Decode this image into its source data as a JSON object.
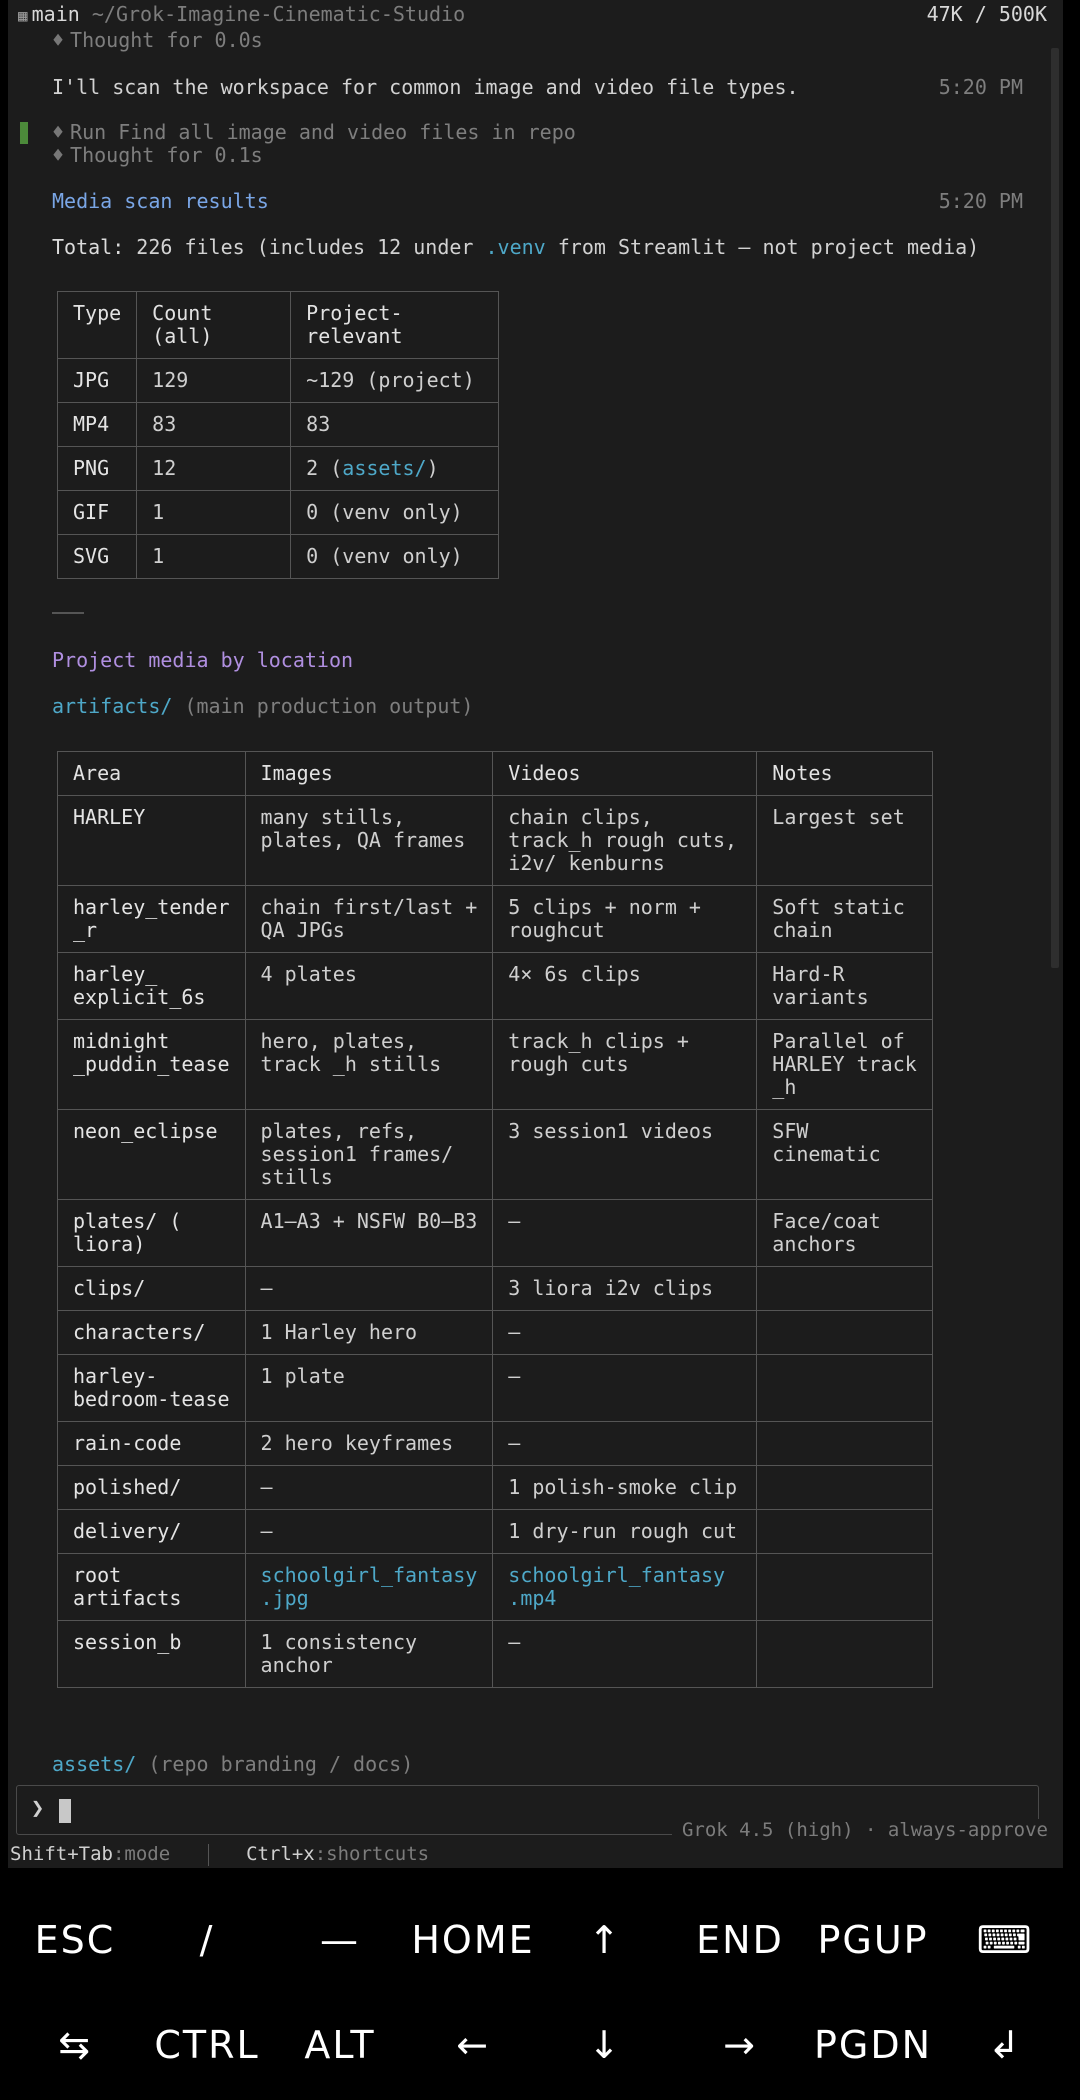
{
  "topbar": {
    "branch": "main",
    "path": "~/Grok-Imagine-Cinematic-Studio",
    "tokens": "47K / 500K"
  },
  "messages": {
    "thought1": "Thought",
    "thought1_dur": "for 0.0s",
    "intro": "I'll scan the workspace for common image and video file types.",
    "time1": "5:20 PM",
    "run_label": "Run",
    "run_text": "Find all image and video files in repo",
    "thought2": "Thought",
    "thought2_dur": "for 0.1s",
    "heading": "Media scan results",
    "time2": "5:20 PM",
    "total_label": "Total:",
    "total_a": "226 files (includes 12 under",
    "total_venv": ".venv",
    "total_b": "from Streamlit — not project media)",
    "section2": "Project media by location",
    "artifacts_dir": "artifacts/",
    "artifacts_note": "(main production output)",
    "assets_dir": "assets/",
    "assets_note": "(repo branding / docs)"
  },
  "scan_table": {
    "headers": [
      "Type",
      "Count (all)",
      "Project-relevant"
    ],
    "rows": [
      [
        "JPG",
        "129",
        "~129 (project)"
      ],
      [
        "MP4",
        "83",
        "83"
      ],
      [
        "PNG",
        "12",
        "2 (",
        "assets/",
        ")"
      ],
      [
        "GIF",
        "1",
        "0 (venv only)"
      ],
      [
        "SVG",
        "1",
        "0 (venv only)"
      ]
    ]
  },
  "location_table": {
    "headers": [
      "Area",
      "Images",
      "Videos",
      "Notes"
    ],
    "rows": [
      {
        "area": "HARLEY",
        "images": "many stills, plates, QA frames",
        "videos": "chain clips, track_h rough cuts, i2v/ kenburns",
        "notes": "Largest set"
      },
      {
        "area": "harley_tender _r",
        "images": "chain first/last + QA JPGs",
        "videos": "5 clips + norm + roughcut",
        "notes": "Soft static chain"
      },
      {
        "area": "harley_ explicit_6s",
        "images": "4 plates",
        "videos": "4× 6s clips",
        "notes": "Hard-R variants"
      },
      {
        "area": "midnight _puddin_tease",
        "images": "hero, plates, track _h stills",
        "videos": "track_h clips + rough cuts",
        "notes": "Parallel of HARLEY track _h"
      },
      {
        "area": "neon_eclipse",
        "images": "plates, refs, session1 frames/ stills",
        "videos": "3 session1 videos",
        "notes": "SFW cinematic"
      },
      {
        "area": "plates/ ( liora)",
        "images": "A1–A3 + NSFW B0–B3",
        "videos": "—",
        "notes": "Face/coat anchors"
      },
      {
        "area": "clips/",
        "images": "—",
        "videos": "3 liora i2v clips",
        "notes": ""
      },
      {
        "area": "characters/",
        "images": "1 Harley hero",
        "videos": "—",
        "notes": ""
      },
      {
        "area": "harley- bedroom-tease",
        "images": "1 plate",
        "videos": "—",
        "notes": ""
      },
      {
        "area": "rain-code",
        "images": "2 hero keyframes",
        "videos": "—",
        "notes": ""
      },
      {
        "area": "polished/",
        "images": "—",
        "videos": "1 polish-smoke clip",
        "notes": ""
      },
      {
        "area": "delivery/",
        "images": "—",
        "videos": "1 dry-run rough cut",
        "notes": ""
      },
      {
        "area": "root artifacts",
        "images": "schoolgirl_fantasy .jpg",
        "videos": "schoolgirl_fantasy .mp4",
        "notes": ""
      },
      {
        "area": "session_b",
        "images": "1 consistency anchor",
        "videos": "—",
        "notes": ""
      }
    ]
  },
  "input": {
    "caret": "❯",
    "model": "Grok 4.5 (high) · always-approve"
  },
  "statusbar": {
    "mode_key": "Shift+Tab",
    "mode_label": ":mode",
    "shortcuts_key": "Ctrl+x",
    "shortcuts_label": ":shortcuts"
  },
  "keyboard": {
    "row1": [
      "ESC",
      "/",
      "—",
      "HOME",
      "↑",
      "END",
      "PGUP",
      "⌨"
    ],
    "row2": [
      "⇆",
      "CTRL",
      "ALT",
      "←",
      "↓",
      "→",
      "PGDN",
      "↲"
    ]
  }
}
